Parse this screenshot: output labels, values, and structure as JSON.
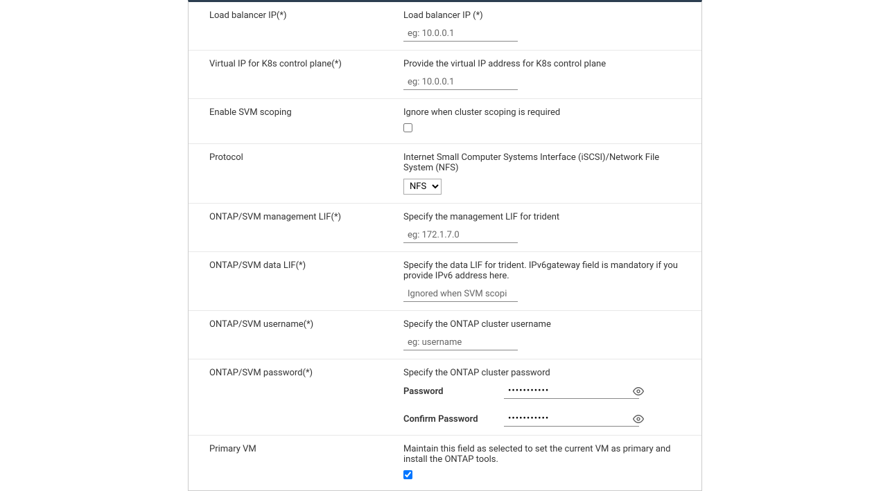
{
  "fields": {
    "loadBalancer": {
      "label": "Load balancer IP(*)",
      "description": "Load balancer IP (*)",
      "placeholder": "eg: 10.0.0.1"
    },
    "virtualIP": {
      "label": "Virtual IP for K8s control plane(*)",
      "description": "Provide the virtual IP address for K8s control plane",
      "placeholder": "eg: 10.0.0.1"
    },
    "svmScoping": {
      "label": "Enable SVM scoping",
      "description": "Ignore when cluster scoping is required"
    },
    "protocol": {
      "label": "Protocol",
      "description": "Internet Small Computer Systems Interface (iSCSI)/Network File System (NFS)",
      "selected": "NFS"
    },
    "mgmtLif": {
      "label": "ONTAP/SVM management LIF(*)",
      "description": "Specify the management LIF for trident",
      "placeholder": "eg: 172.1.7.0"
    },
    "dataLif": {
      "label": "ONTAP/SVM data LIF(*)",
      "description": "Specify the data LIF for trident. IPv6gateway field is mandatory if you provide IPv6 address here.",
      "placeholder": "Ignored when SVM scopi"
    },
    "username": {
      "label": "ONTAP/SVM username(*)",
      "description": "Specify the ONTAP cluster username",
      "placeholder": "eg: username"
    },
    "password": {
      "label": "ONTAP/SVM password(*)",
      "description": "Specify the ONTAP cluster password",
      "passwordLabel": "Password",
      "confirmLabel": "Confirm Password",
      "value": "•••••••••••"
    },
    "primaryVM": {
      "label": "Primary VM",
      "description": "Maintain this field as selected to set the current VM as primary and install the ONTAP tools."
    }
  }
}
